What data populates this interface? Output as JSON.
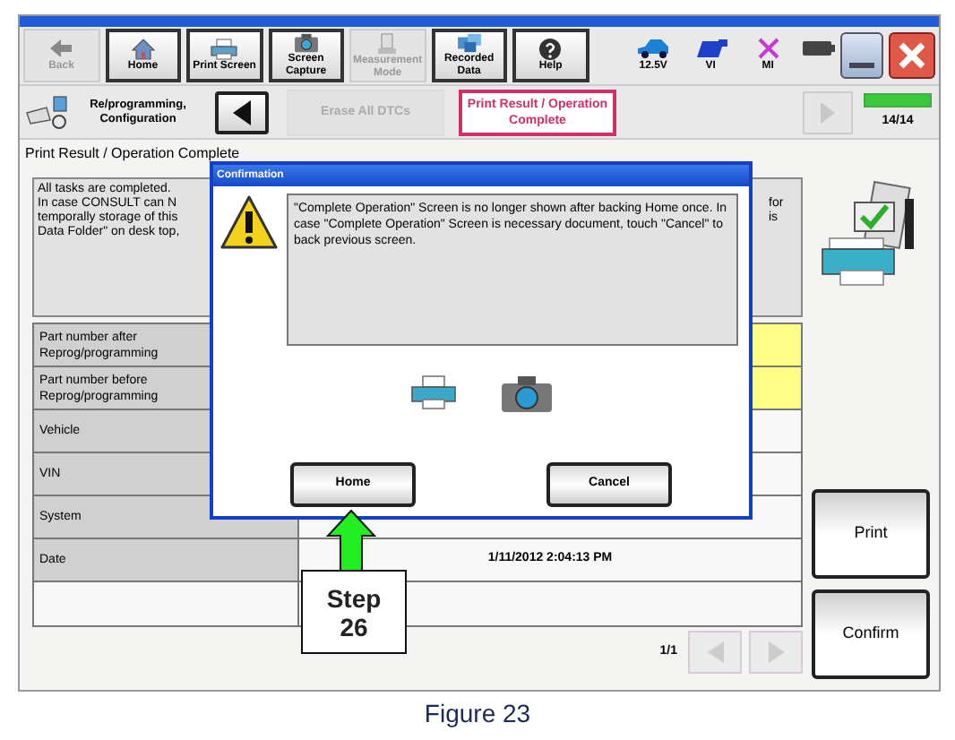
{
  "toolbar": {
    "buttons": [
      {
        "label": "Back",
        "kind": "back",
        "disabled": true
      },
      {
        "label": "Home",
        "kind": "home",
        "disabled": false
      },
      {
        "label": "Print Screen",
        "kind": "printer",
        "disabled": false
      },
      {
        "label": "Screen Capture",
        "kind": "camera",
        "disabled": false
      },
      {
        "label": "Measurement Mode",
        "kind": "meter",
        "disabled": true
      },
      {
        "label": "Recorded Data",
        "kind": "data",
        "disabled": false
      },
      {
        "label": "Help",
        "kind": "help",
        "disabled": false
      }
    ],
    "status": [
      {
        "label": "12.5V",
        "kind": "car"
      },
      {
        "label": "VI",
        "kind": "vi"
      },
      {
        "label": "MI",
        "kind": "mi"
      }
    ]
  },
  "steps": {
    "title": "Re/programming, Configuration",
    "items": [
      {
        "label": "Erase All DTCs",
        "selected": false
      },
      {
        "label": "Print Result / Operation Complete",
        "selected": true
      }
    ]
  },
  "progress": {
    "label": "14/14",
    "level": 1
  },
  "page_title": "Print Result / Operation Complete",
  "message_lines": [
    "All tasks are completed.",
    "In case CONSULT can N",
    "temporally storage of this",
    "Data Folder\" on desk top,"
  ],
  "message_fragments": [
    "for",
    "is"
  ],
  "rows": [
    {
      "label": "Part number after Reprog/programming",
      "highlight": true
    },
    {
      "label": "Part number before Reprog/programming",
      "highlight": true
    },
    {
      "label": "Vehicle",
      "highlight": false
    },
    {
      "label": "VIN",
      "highlight": false
    },
    {
      "label": "System",
      "highlight": false
    },
    {
      "label": "Date",
      "highlight": false,
      "value": "1/11/2012 2:04:13 PM"
    },
    {
      "highlight": false
    }
  ],
  "pager": "1/1",
  "side_buttons": [
    "Print",
    "Confirm"
  ],
  "dialog": {
    "title": "Confirmation",
    "message": "\"Complete Operation\" Screen is no longer shown after backing Home once. In case \"Complete Operation\" Screen is necessary document, touch \"Cancel\" to back previous screen.",
    "buttons": [
      "Home",
      "Cancel"
    ]
  },
  "callout": {
    "lines": [
      "Step",
      "26"
    ]
  },
  "caption": "Figure 23"
}
